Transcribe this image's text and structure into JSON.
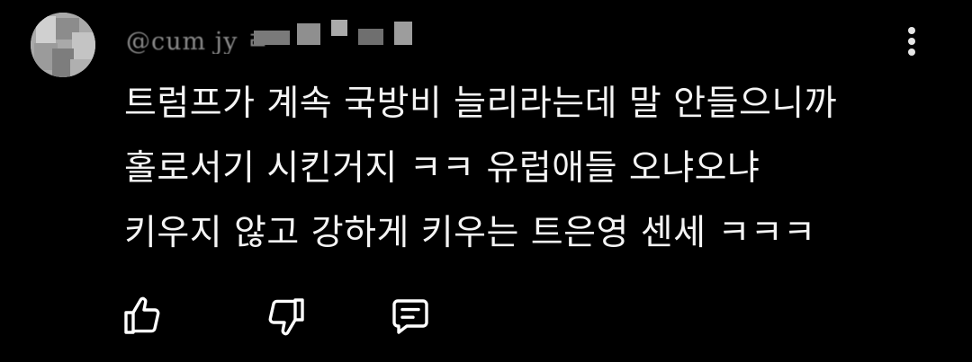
{
  "comment": {
    "author": "@cum   jy   ㄹ",
    "lines": [
      "트럼프가 계속 국방비 늘리라는데 말 안들으니까",
      "홀로서기 시킨거지 ㅋㅋ 유럽애들 오냐오냐",
      "키우지 않고 강하게 키우는 트은영 센세 ㅋㅋㅋ"
    ]
  },
  "icons": {
    "more": "more-vertical-icon",
    "like": "thumbs-up-icon",
    "dislike": "thumbs-down-icon",
    "reply": "comment-icon"
  },
  "colors": {
    "background": "#000000",
    "text": "#f4f4f4",
    "author": "#8a8a8a",
    "icon": "#ffffff"
  }
}
